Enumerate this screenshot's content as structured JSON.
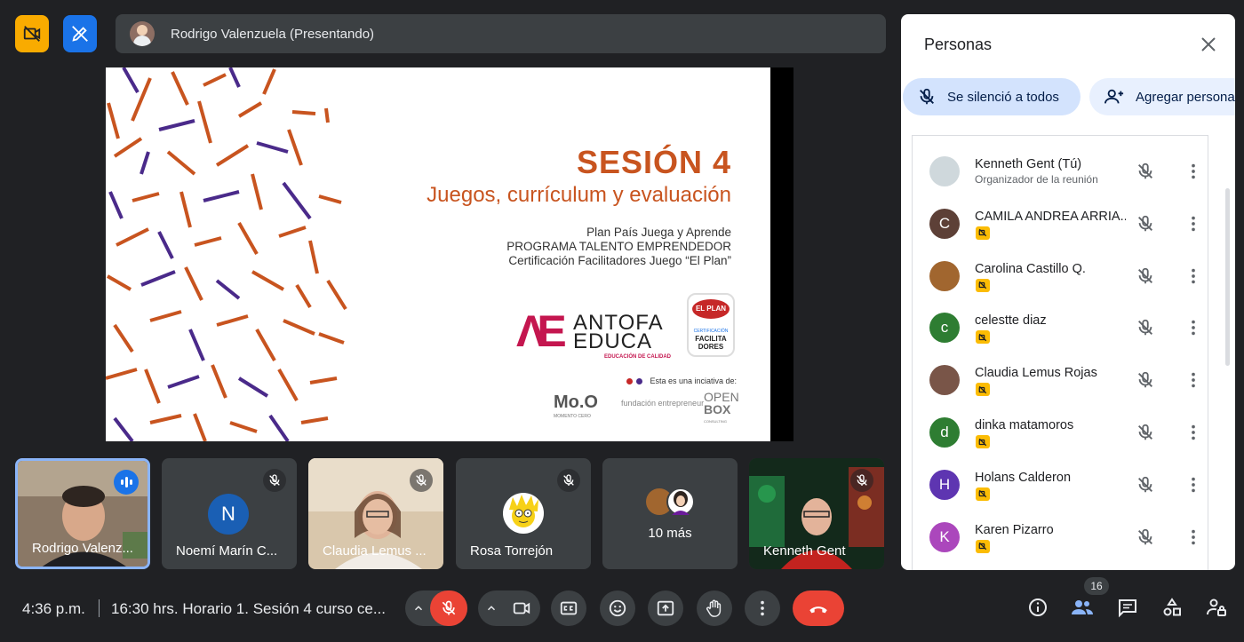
{
  "presenter_bar": {
    "label": "Rodrigo Valenzuela (Presentando)"
  },
  "slide": {
    "title": "SESIÓN 4",
    "subtitle": "Juegos, currículum y evaluación",
    "line1": "Plan País Juega y Aprende",
    "line2": "PROGRAMA TALENTO EMPRENDEDOR",
    "line3": "Certificación Facilitadores Juego “El Plan”",
    "logo_line1": "ANTOFA",
    "logo_line2": "EDUCA",
    "logo_tag": "EDUCACIÓN DE CALIDAD",
    "badge_top": "EL PLAN",
    "badge_cert": "CERTIFICACIÓN",
    "badge_main": "FACILITA DORES",
    "initiative": "Esta es una inciativa de:",
    "sponsor1": "Mo.O",
    "sponsor1_sub": "MOMENTO CERO",
    "sponsor2": "fundación entrepreneur",
    "sponsor3_a": "OPEN",
    "sponsor3_b": "BOX",
    "sponsor3_sub": "CONSULTING",
    "accent_orange": "#c8541f",
    "accent_purple": "#4a2a8a"
  },
  "tiles": [
    {
      "name": "Rodrigo Valenz...",
      "speaking": true
    },
    {
      "name": "Noemí Marín C...",
      "initial": "N",
      "color": "#1a5fb4",
      "muted": true
    },
    {
      "name": "Claudia Lemus ...",
      "muted": true
    },
    {
      "name": "Rosa Torrejón",
      "muted": true
    },
    {
      "name": "10 más"
    },
    {
      "name": "Kenneth Gent",
      "muted": true
    }
  ],
  "panel": {
    "title": "Personas",
    "mute_all": "Se silenció a todos",
    "add_people": "Agregar personas",
    "people": [
      {
        "name": "Kenneth Gent (Tú)",
        "role": "Organizador de la reunión",
        "initial": "",
        "color": "#cfd8dc"
      },
      {
        "name": "CAMILA ANDREA ARRIA...",
        "initial": "C",
        "color": "#5d4037"
      },
      {
        "name": "Carolina Castillo Q.",
        "initial": "",
        "color": "#a1662f"
      },
      {
        "name": "celestte diaz",
        "initial": "c",
        "color": "#2e7d32"
      },
      {
        "name": "Claudia Lemus Rojas",
        "initial": "",
        "color": "#795548"
      },
      {
        "name": "dinka matamoros",
        "initial": "d",
        "color": "#2e7d32"
      },
      {
        "name": "Holans Calderon",
        "initial": "H",
        "color": "#5e35b1"
      },
      {
        "name": "Karen Pizarro",
        "initial": "K",
        "color": "#ab47bc"
      }
    ]
  },
  "bottom": {
    "time": "4:36 p.m.",
    "meeting_title": "16:30 hrs. Horario 1. Sesión 4 curso ce...",
    "participants_count": "16",
    "end_color": "#ea4335"
  }
}
